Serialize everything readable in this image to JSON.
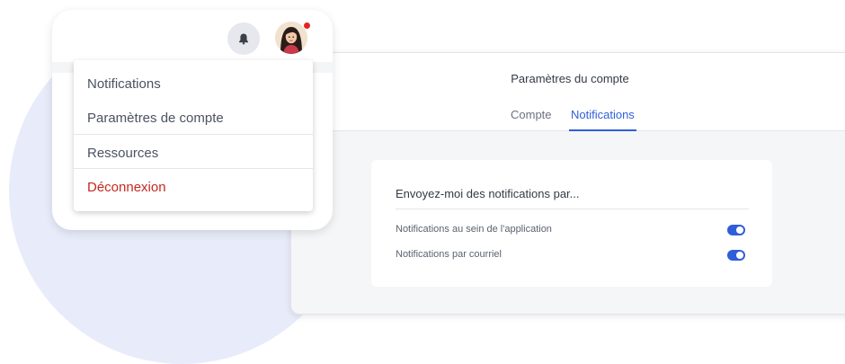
{
  "header": {
    "menu": {
      "items": [
        {
          "label": "Notifications"
        },
        {
          "label": "Paramètres de compte"
        },
        {
          "label": "Ressources"
        },
        {
          "label": "Déconnexion"
        }
      ]
    },
    "icons": {
      "bell": "bell-icon",
      "avatar": "user-avatar"
    },
    "colors": {
      "logout": "#c8281f",
      "avatar_dot": "#e0271f"
    }
  },
  "settings": {
    "title": "Paramètres du compte",
    "tabs": [
      {
        "label": "Compte",
        "active": false
      },
      {
        "label": "Notifications",
        "active": true
      }
    ],
    "card": {
      "heading": "Envoyez-moi des notifications par...",
      "rows": [
        {
          "label": "Notifications au sein de l'application",
          "enabled": true
        },
        {
          "label": "Notifications par courriel",
          "enabled": true
        }
      ]
    },
    "colors": {
      "accent": "#2f5fd8"
    }
  }
}
